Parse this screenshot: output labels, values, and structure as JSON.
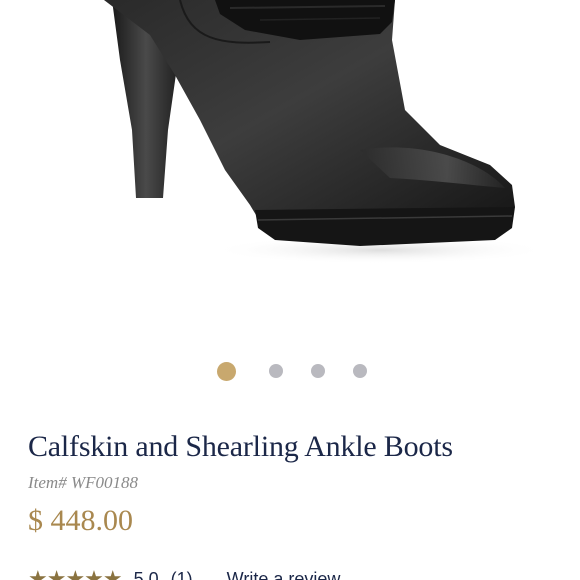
{
  "product": {
    "title": "Calfskin and Shearling Ankle Boots",
    "item_number": "Item# WF00188",
    "price": "$ 448.00"
  },
  "gallery": {
    "image_count": 4,
    "active_index": 0
  },
  "rating": {
    "stars": "★★★★★",
    "score": "5.0",
    "count": "(1)",
    "write_review_label": "Write a review"
  },
  "colors": {
    "title": "#1b2748",
    "price": "#a9884f",
    "active_dot": "#c8a86e",
    "inactive_dot": "#b9b9bf",
    "star": "#8a7340"
  }
}
